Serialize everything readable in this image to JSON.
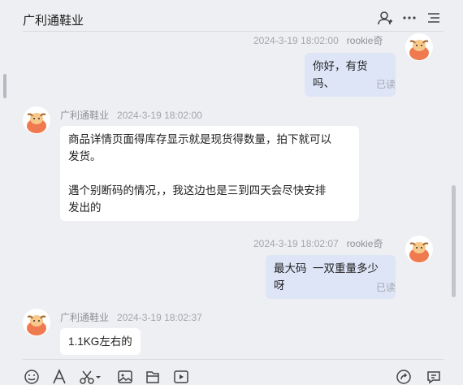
{
  "header": {
    "title": "广利通鞋业",
    "icons": [
      "add-user-icon",
      "more-icon",
      "menu-list-icon"
    ]
  },
  "messages": [
    {
      "side": "mine",
      "timestamp": "2024-3-19 18:02:00",
      "sender": "rookie奇",
      "text": "你好，有货吗、",
      "status": "已读"
    },
    {
      "side": "theirs",
      "sender": "广利通鞋业",
      "timestamp": "2024-3-19 18:02:00",
      "text": "商品详情页面得库存显示就是现货得数量，拍下就可以\n发货。\n\n遇个别断码的情况，，我这边也是三到四天会尽快安排\n发出的"
    },
    {
      "side": "mine",
      "timestamp": "2024-3-19 18:02:07",
      "sender": "rookie奇",
      "text": "最大码  一双重量多少呀",
      "status": "已读"
    },
    {
      "side": "theirs",
      "sender": "广利通鞋业",
      "timestamp": "2024-3-19 18:02:37",
      "text": "1.1KG左右的"
    }
  ],
  "toolbar": {
    "icons": [
      "emoji-icon",
      "font-icon",
      "scissors-icon",
      "image-icon",
      "file-icon",
      "video-icon",
      "share-icon",
      "chat-settings-icon"
    ]
  },
  "colors": {
    "background": "#eeeff2",
    "my_bubble": "#dde5f7",
    "their_bubble": "#ffffff",
    "avatar_orange": "#f07a4f"
  }
}
